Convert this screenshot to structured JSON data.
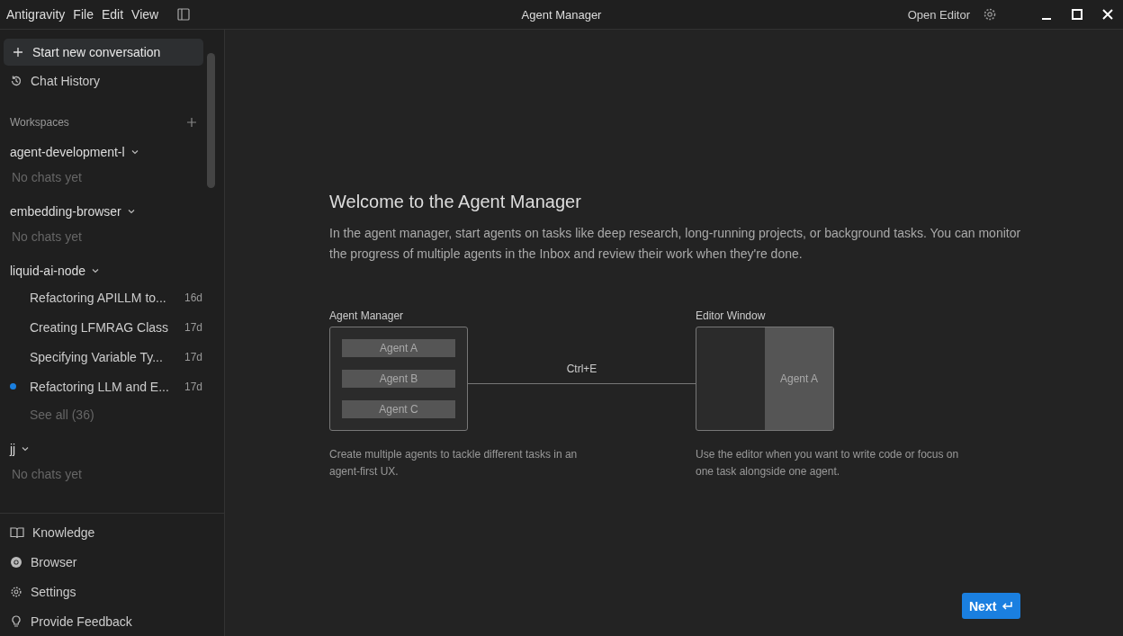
{
  "titlebar": {
    "app_name": "Antigravity",
    "menus": [
      "File",
      "Edit",
      "View"
    ],
    "title": "Agent Manager",
    "open_editor": "Open Editor"
  },
  "sidebar": {
    "new_conversation": "Start new conversation",
    "chat_history": "Chat History",
    "workspaces_heading": "Workspaces",
    "workspaces": [
      {
        "name": "agent-development-l",
        "expanded": true,
        "empty_text": "No chats yet"
      },
      {
        "name": "embedding-browser",
        "expanded": true,
        "empty_text": "No chats yet"
      },
      {
        "name": "liquid-ai-node",
        "expanded": true,
        "chats": [
          {
            "title": "Refactoring APILLM to...",
            "age": "16d",
            "unread": false
          },
          {
            "title": "Creating LFMRAG Class",
            "age": "17d",
            "unread": false
          },
          {
            "title": "Specifying Variable Ty...",
            "age": "17d",
            "unread": false
          },
          {
            "title": "Refactoring LLM and E...",
            "age": "17d",
            "unread": true
          }
        ],
        "see_all": "See all (36)"
      },
      {
        "name": "jj",
        "expanded": true,
        "empty_text": "No chats yet"
      }
    ],
    "footer": [
      {
        "kind": "knowledge",
        "label": "Knowledge"
      },
      {
        "kind": "browser",
        "label": "Browser"
      },
      {
        "kind": "settings",
        "label": "Settings"
      },
      {
        "kind": "feedback",
        "label": "Provide Feedback"
      }
    ]
  },
  "welcome": {
    "heading": "Welcome to the Agent Manager",
    "body": "In the agent manager, start agents on tasks like deep research, long-running projects, or background tasks. You can monitor the progress of multiple agents in the Inbox and review their work when they're done.",
    "diagram": {
      "left_title": "Agent Manager",
      "agents": [
        "Agent A",
        "Agent B",
        "Agent C"
      ],
      "shortcut": "Ctrl+E",
      "right_title": "Editor Window",
      "editor_agent": "Agent A",
      "left_caption": "Create multiple agents to tackle different tasks in an agent-first UX.",
      "right_caption": "Use the editor when you want to write code or focus on one task alongside one agent."
    },
    "next_button": "Next"
  }
}
